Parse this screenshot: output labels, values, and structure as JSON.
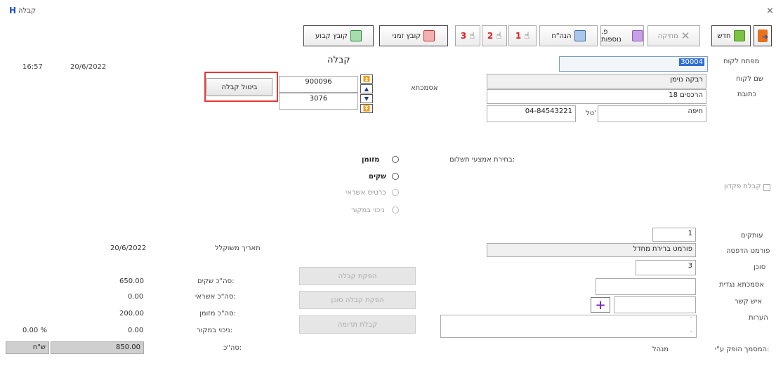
{
  "window": {
    "title": "קבלה",
    "logo": "H",
    "close": "×"
  },
  "toolbar": {
    "exit": "",
    "new": "חדש",
    "delete": "מחיקה",
    "extra_fields": "פ. נוספות",
    "calc": "הנה\"ח",
    "copy1": "1",
    "copy2": "2",
    "copy3": "3",
    "temp_file": "קובץ זמני",
    "fixed_file": "קובץ קבוע"
  },
  "header": {
    "title": "קבלה",
    "time": "16:57",
    "date": "20/6/2022"
  },
  "customer": {
    "key_label": "מפתח לקוח",
    "key_value": "30004",
    "name_label": "שם לקוח",
    "name_value": "רבקה נוימן",
    "address_label": "כתובת",
    "address_value": "הרכסים 18",
    "city_value": "חיפה",
    "phone_label": "טל'",
    "phone_value": "04-84543221"
  },
  "credit": {
    "label": "אסמכתא",
    "doc_value": "900096",
    "second_value": "3076",
    "cancel_label": "ביטול קבלה"
  },
  "payment": {
    "label": "בחירת אמצעי תשלום:",
    "cash": "מזומן",
    "checks": "שקים",
    "credit_cards": "כרטיס אשראי",
    "withholding": "ניכוי במקור"
  },
  "deposit_receipt": "קבלת פקדון",
  "form": {
    "copies_label": "עותקים",
    "copies_value": "1",
    "print_format_label": "פורמט הדפסה",
    "print_format_value": "פורמט ברירת מחדל",
    "agent_label": "סוכן",
    "agent_value": "3",
    "ref_label": "אסמכתא נגדית",
    "contact_label": "איש קשר",
    "notes_label": "הערות",
    "issued_by_label": "המסמך הופק ע\"י:",
    "issued_by_value": "מנהל"
  },
  "summary": {
    "date_label": "תאריך משוקלל",
    "date_value": "20/6/2022",
    "checks_total_label": "סה\"כ שקים:",
    "checks_total": "650.00",
    "credit_total_label": "סה\"כ אשראי:",
    "credit_total": "0.00",
    "cash_total_label": "סה\"כ מזומן:",
    "cash_total": "200.00",
    "withholding_label": "ניכוי במקור:",
    "withholding_value": "0.00",
    "withholding_pct": "0.00 %",
    "total_label": "סה\"כ:",
    "total_value": "850.00",
    "currency": "ש\"ח"
  },
  "actions": {
    "issue_receipt": "הפקת קבלה",
    "issue_agent_receipt": "הפקת קבלה סוכן",
    "donation_receipt": "קבלת תרומה"
  }
}
